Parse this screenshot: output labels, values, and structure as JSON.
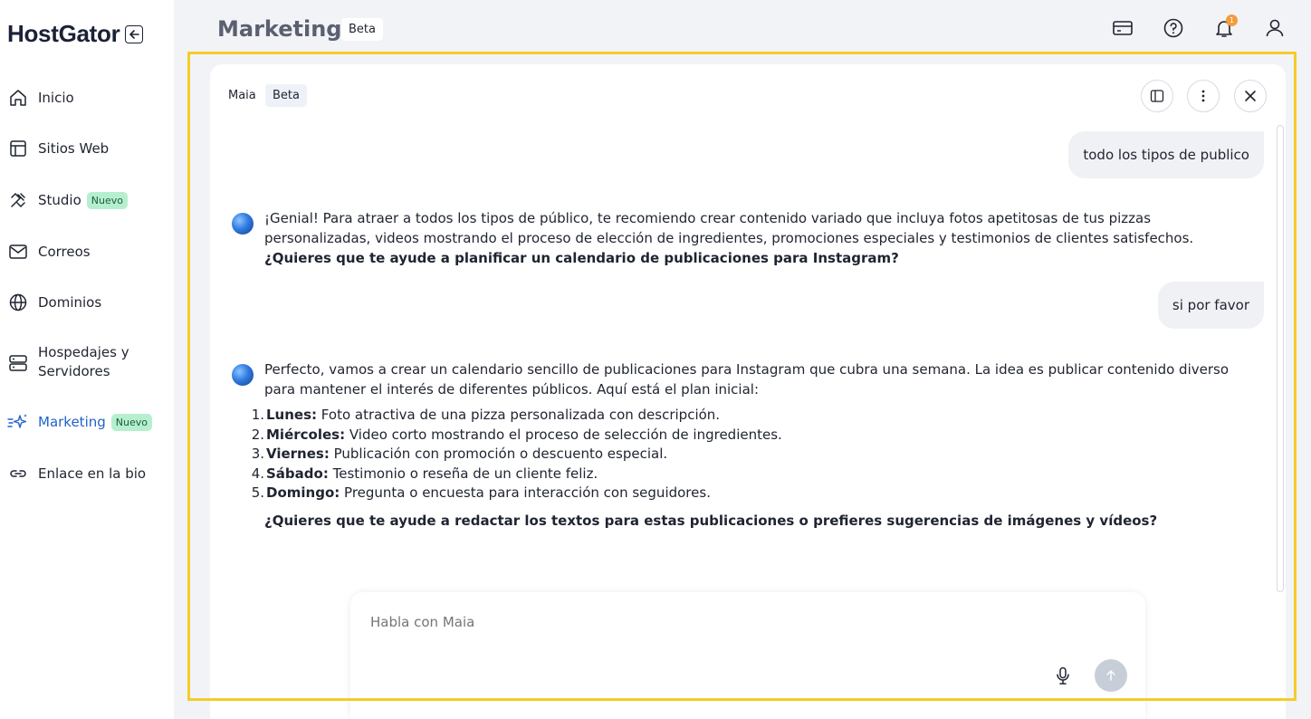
{
  "brand": {
    "logo": "HostGator"
  },
  "sidebar": {
    "items": [
      {
        "label": "Inicio",
        "icon": "home-icon"
      },
      {
        "label": "Sitios Web",
        "icon": "layout-icon"
      },
      {
        "label": "Studio",
        "icon": "design-tools-icon",
        "badge": "Nuevo"
      },
      {
        "label": "Correos",
        "icon": "mail-icon"
      },
      {
        "label": "Dominios",
        "icon": "globe-icon"
      },
      {
        "label_line1": "Hospedajes y",
        "label_line2": "Servidores",
        "icon": "server-icon"
      },
      {
        "label": "Marketing",
        "icon": "sparkle-icon",
        "badge": "Nuevo",
        "active": true
      },
      {
        "label": "Enlace en la bio",
        "icon": "link-icon"
      }
    ]
  },
  "header": {
    "title": "Marketing",
    "badge": "Beta",
    "notification_count": "1"
  },
  "chat": {
    "assistant_name": "Maia",
    "badge": "Beta",
    "messages": [
      {
        "role": "user",
        "text": "todo los tipos de publico"
      },
      {
        "role": "assistant",
        "text": "¡Genial! Para atraer a todos los tipos de público, te recomiendo crear contenido variado que incluya fotos apetitosas de tus pizzas personalizadas, videos mostrando el proceso de elección de ingredientes, promociones especiales y testimonios de clientes satisfechos.",
        "question": "¿Quieres que te ayude a planificar un calendario de publicaciones para Instagram?"
      },
      {
        "role": "user",
        "text": "si por favor"
      },
      {
        "role": "assistant",
        "intro": "Perfecto, vamos a crear un calendario sencillo de publicaciones para Instagram que cubra una semana. La idea es publicar contenido diverso para mantener el interés de diferentes públicos. Aquí está el plan inicial:",
        "plan": [
          {
            "num": "1.",
            "day": "Lunes:",
            "text": "Foto atractiva de una pizza personalizada con descripción."
          },
          {
            "num": "2.",
            "day": "Miércoles:",
            "text": "Video corto mostrando el proceso de selección de ingredientes."
          },
          {
            "num": "3.",
            "day": "Viernes:",
            "text": "Publicación con promoción o descuento especial."
          },
          {
            "num": "4.",
            "day": "Sábado:",
            "text": "Testimonio o reseña de un cliente feliz."
          },
          {
            "num": "5.",
            "day": "Domingo:",
            "text": "Pregunta o encuesta para interacción con seguidores."
          }
        ],
        "question": "¿Quieres que te ayude a redactar los textos para estas publicaciones o prefieres sugerencias de imágenes y vídeos?"
      }
    ],
    "composer": {
      "placeholder": "Habla con Maia"
    }
  },
  "colors": {
    "accent": "#2163c9",
    "badge_new_bg": "#b6efd0",
    "focus_frame": "#f4cc2a"
  }
}
